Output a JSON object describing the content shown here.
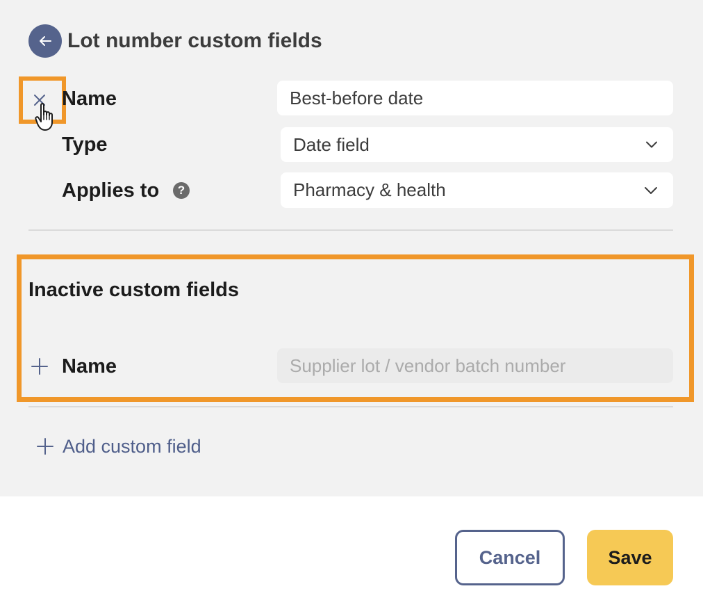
{
  "header": {
    "title": "Lot number custom fields",
    "back_icon": "arrow-left-icon"
  },
  "active_field": {
    "remove_icon": "close-icon",
    "name_label": "Name",
    "name_value": "Best-before date",
    "type_label": "Type",
    "type_value": "Date field",
    "applies_label": "Applies to",
    "applies_help": "?",
    "applies_value": "Pharmacy & health"
  },
  "inactive_section": {
    "title": "Inactive custom fields",
    "fields": [
      {
        "add_icon": "plus-icon",
        "name_label": "Name",
        "name_value": "Supplier lot / vendor batch number"
      }
    ]
  },
  "add_custom_field": {
    "label": "Add custom field",
    "icon": "plus-icon"
  },
  "footer": {
    "cancel_label": "Cancel",
    "save_label": "Save"
  },
  "colors": {
    "accent": "#55638c",
    "highlight": "#f0972a",
    "save": "#f6c955",
    "panel_bg": "#f2f2f2"
  }
}
